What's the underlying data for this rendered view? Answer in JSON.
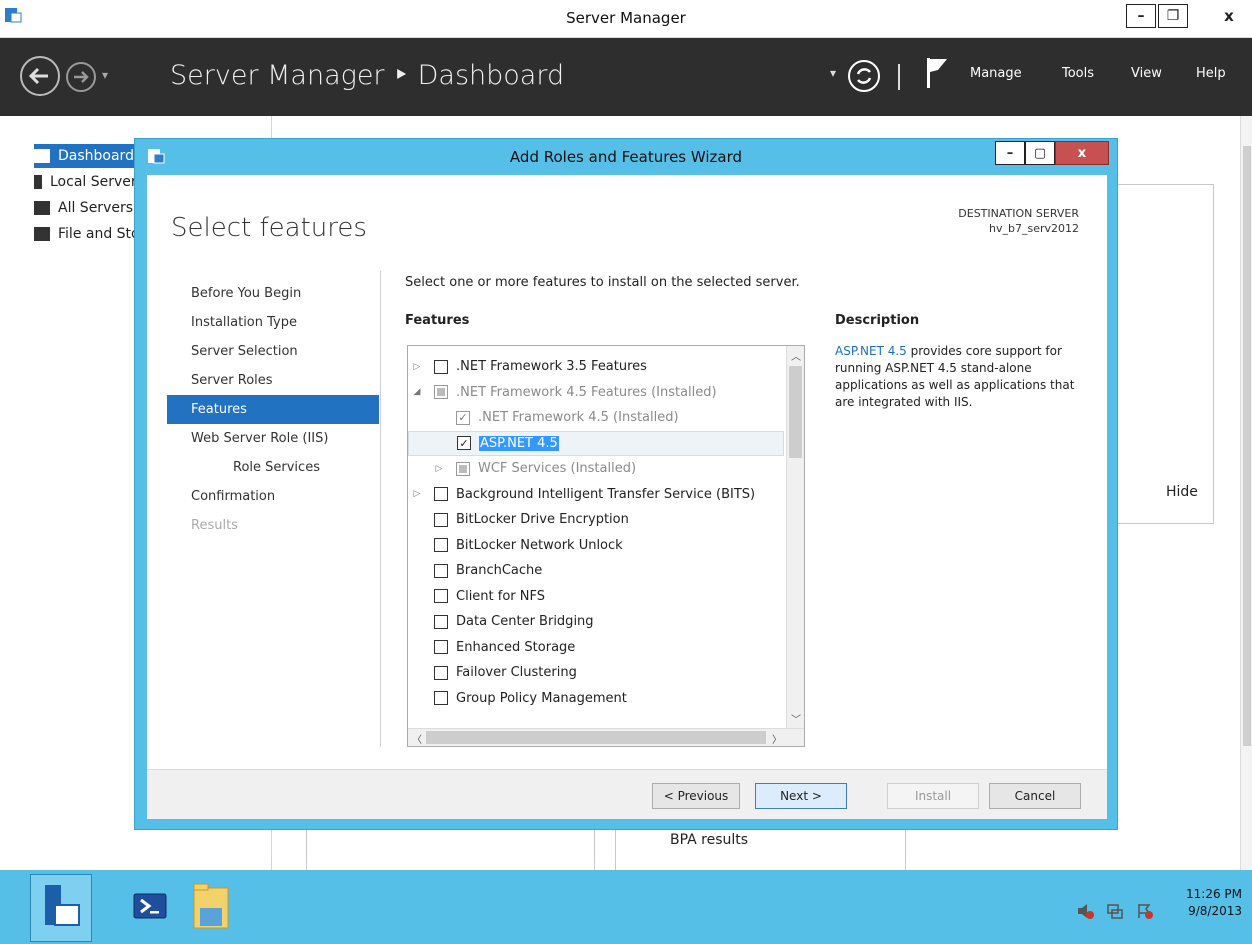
{
  "window": {
    "title": "Server Manager"
  },
  "header": {
    "breadcrumb": "Server Manager  ‣  Dashboard",
    "menus": [
      "Manage",
      "Tools",
      "View",
      "Help"
    ]
  },
  "left_nav": {
    "items": [
      {
        "label": "Dashboard",
        "selected": true
      },
      {
        "label": "Local Server",
        "selected": false
      },
      {
        "label": "All Servers",
        "selected": false
      },
      {
        "label": "File and Storage Services",
        "selected": false
      }
    ]
  },
  "background": {
    "hide_label": "Hide",
    "bpa_label": "BPA results"
  },
  "wizard": {
    "title": "Add Roles and Features Wizard",
    "page_title": "Select features",
    "destination_label": "DESTINATION SERVER",
    "destination_value": "hv_b7_serv2012",
    "steps": [
      {
        "label": "Before You Begin",
        "state": "normal"
      },
      {
        "label": "Installation Type",
        "state": "normal"
      },
      {
        "label": "Server Selection",
        "state": "normal"
      },
      {
        "label": "Server Roles",
        "state": "normal"
      },
      {
        "label": "Features",
        "state": "active"
      },
      {
        "label": "Web Server Role (IIS)",
        "state": "normal"
      },
      {
        "label": "Role Services",
        "state": "sub"
      },
      {
        "label": "Confirmation",
        "state": "normal"
      },
      {
        "label": "Results",
        "state": "disabled"
      }
    ],
    "instruction": "Select one or more features to install on the selected server.",
    "features_heading": "Features",
    "description_heading": "Description",
    "description_link": "ASP.NET 4.5",
    "description_text": " provides core support for running ASP.NET 4.5 stand-alone applications as well as applications that are integrated with IIS.",
    "features": [
      {
        "label": ".NET Framework 3.5 Features",
        "indent": 0,
        "expander": "▷",
        "check": "unchecked",
        "gray": false,
        "selected": false
      },
      {
        "label": ".NET Framework 4.5 Features (Installed)",
        "indent": 0,
        "expander": "◢",
        "check": "indeterminate",
        "gray": true,
        "selected": false
      },
      {
        "label": ".NET Framework 4.5 (Installed)",
        "indent": 1,
        "expander": "",
        "check": "checked",
        "gray": true,
        "selected": false
      },
      {
        "label": "ASP.NET 4.5",
        "indent": 1,
        "expander": "",
        "check": "checked",
        "gray": false,
        "selected": true
      },
      {
        "label": "WCF Services (Installed)",
        "indent": 1,
        "expander": "▷",
        "check": "indeterminate",
        "gray": true,
        "selected": false
      },
      {
        "label": "Background Intelligent Transfer Service (BITS)",
        "indent": 0,
        "expander": "▷",
        "check": "unchecked",
        "gray": false,
        "selected": false
      },
      {
        "label": "BitLocker Drive Encryption",
        "indent": 0,
        "expander": "",
        "check": "unchecked",
        "gray": false,
        "selected": false
      },
      {
        "label": "BitLocker Network Unlock",
        "indent": 0,
        "expander": "",
        "check": "unchecked",
        "gray": false,
        "selected": false
      },
      {
        "label": "BranchCache",
        "indent": 0,
        "expander": "",
        "check": "unchecked",
        "gray": false,
        "selected": false
      },
      {
        "label": "Client for NFS",
        "indent": 0,
        "expander": "",
        "check": "unchecked",
        "gray": false,
        "selected": false
      },
      {
        "label": "Data Center Bridging",
        "indent": 0,
        "expander": "",
        "check": "unchecked",
        "gray": false,
        "selected": false
      },
      {
        "label": "Enhanced Storage",
        "indent": 0,
        "expander": "",
        "check": "unchecked",
        "gray": false,
        "selected": false
      },
      {
        "label": "Failover Clustering",
        "indent": 0,
        "expander": "",
        "check": "unchecked",
        "gray": false,
        "selected": false
      },
      {
        "label": "Group Policy Management",
        "indent": 0,
        "expander": "",
        "check": "unchecked",
        "gray": false,
        "selected": false
      }
    ],
    "buttons": {
      "previous": "< Previous",
      "next": "Next >",
      "install": "Install",
      "cancel": "Cancel"
    }
  },
  "taskbar": {
    "time": "11:26 PM",
    "date": "9/8/2013"
  },
  "colors": {
    "accent": "#2272c2",
    "chrome": "#56bfe8",
    "header": "#2e2e2e",
    "close": "#c75050"
  }
}
